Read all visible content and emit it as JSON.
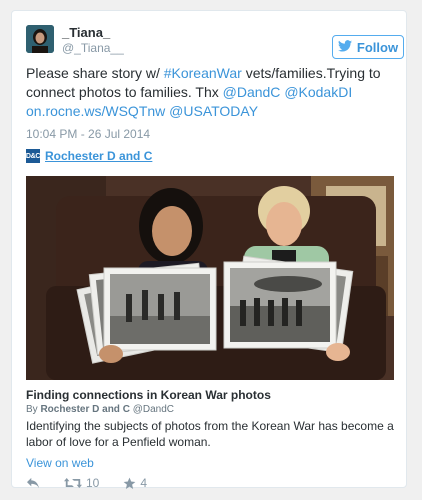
{
  "tweet": {
    "display_name": "_Tiana_",
    "handle": "@_Tiana__",
    "follow_label": "Follow",
    "text_parts": [
      {
        "text": "Please share story w/ ",
        "link": false
      },
      {
        "text": "#KoreanWar",
        "link": true
      },
      {
        "text": " vets/families.Trying to connect photos to families. Thx ",
        "link": false
      },
      {
        "text": "@DandC",
        "link": true
      },
      {
        "text": " ",
        "link": false
      },
      {
        "text": "@KodakDI",
        "link": true
      },
      {
        "text": " ",
        "link": false
      },
      {
        "text": "on.rocne.ws/WSQTnw",
        "link": true
      },
      {
        "text": " ",
        "link": false
      },
      {
        "text": "@USATODAY",
        "link": true
      }
    ],
    "timestamp": "10:04 PM - 26 Jul 2014"
  },
  "card": {
    "source_logo_text": "D&C",
    "source_name": "Rochester D and C",
    "title": "Finding connections in Korean War photos",
    "byline_prefix": "By",
    "byline_name": "Rochester D and C",
    "byline_handle": "@DandC",
    "summary": "Identifying the subjects of photos from the Korean War has become a labor of love for a Penfield woman.",
    "view_link": "View on web"
  },
  "actions": {
    "reply_icon": "reply-icon",
    "retweet_icon": "retweet-icon",
    "favorite_icon": "star-icon",
    "retweet_count": "10",
    "favorite_count": "4"
  },
  "colors": {
    "link": "#3b94d9",
    "text": "#292f33",
    "muted": "#8899a6",
    "follow_border": "#55acee"
  }
}
